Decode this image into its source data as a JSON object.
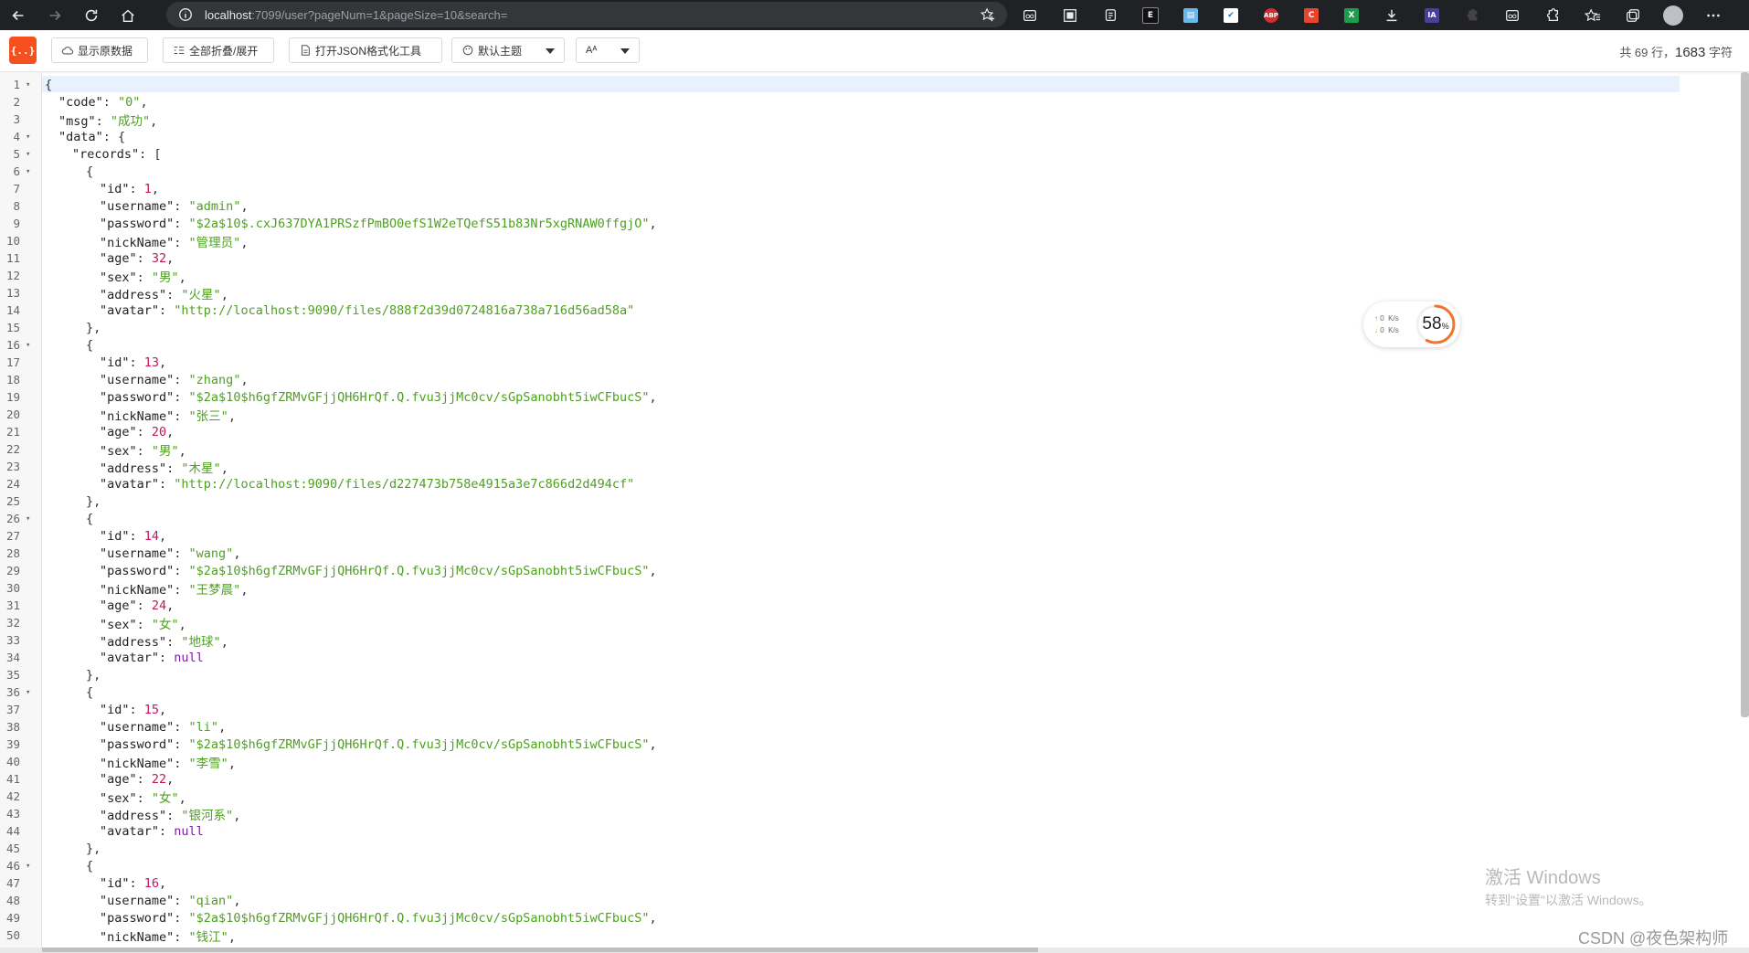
{
  "browser": {
    "url_host": "localhost",
    "url_rest": ":7099/user?pageNum=1&pageSize=10&search="
  },
  "toolbar": {
    "logo_text": "{..}",
    "show_raw_label": "显示原数据",
    "collapse_all_label": "全部折叠/展开",
    "open_tool_label": "打开JSON格式化工具",
    "theme_label": "默认主题",
    "font_label": "Aᴬ",
    "stats_lines": "共 69 行，",
    "stats_chars": "1683",
    "stats_chars_unit": " 字符"
  },
  "speed_widget": {
    "up_value": "0",
    "down_value": "0",
    "unit": "K/s",
    "percent": "58",
    "percent_sign": "%",
    "percent_fraction": 0.58
  },
  "watermark": {
    "title": "激活 Windows",
    "subtitle": "转到\"设置\"以激活 Windows。"
  },
  "csdn": "CSDN @夜色架构师",
  "json_lines": [
    {
      "n": "1",
      "f": "▾",
      "i": 0,
      "t": [
        [
          "b",
          "{"
        ]
      ]
    },
    {
      "n": "2",
      "f": "",
      "i": 1,
      "t": [
        [
          "k",
          "\"code\""
        ],
        [
          "p",
          ": "
        ],
        [
          "s",
          "\"0\""
        ],
        [
          "p",
          ","
        ]
      ]
    },
    {
      "n": "3",
      "f": "",
      "i": 1,
      "t": [
        [
          "k",
          "\"msg\""
        ],
        [
          "p",
          ": "
        ],
        [
          "s",
          "\"成功\""
        ],
        [
          "p",
          ","
        ]
      ]
    },
    {
      "n": "4",
      "f": "▾",
      "i": 1,
      "t": [
        [
          "k",
          "\"data\""
        ],
        [
          "p",
          ": "
        ],
        [
          "b",
          "{"
        ]
      ]
    },
    {
      "n": "5",
      "f": "▾",
      "i": 2,
      "t": [
        [
          "k",
          "\"records\""
        ],
        [
          "p",
          ": "
        ],
        [
          "b",
          "["
        ]
      ]
    },
    {
      "n": "6",
      "f": "▾",
      "i": 3,
      "t": [
        [
          "b",
          "{"
        ]
      ]
    },
    {
      "n": "7",
      "f": "",
      "i": 4,
      "t": [
        [
          "k",
          "\"id\""
        ],
        [
          "p",
          ": "
        ],
        [
          "n",
          "1"
        ],
        [
          "p",
          ","
        ]
      ]
    },
    {
      "n": "8",
      "f": "",
      "i": 4,
      "t": [
        [
          "k",
          "\"username\""
        ],
        [
          "p",
          ": "
        ],
        [
          "s",
          "\"admin\""
        ],
        [
          "p",
          ","
        ]
      ]
    },
    {
      "n": "9",
      "f": "",
      "i": 4,
      "t": [
        [
          "k",
          "\"password\""
        ],
        [
          "p",
          ": "
        ],
        [
          "s",
          "\"$2a$10$.cxJ637DYA1PRSzfPmBO0efS1W2eTQefS51b83Nr5xgRNAW0ffgjO\""
        ],
        [
          "p",
          ","
        ]
      ]
    },
    {
      "n": "10",
      "f": "",
      "i": 4,
      "t": [
        [
          "k",
          "\"nickName\""
        ],
        [
          "p",
          ": "
        ],
        [
          "s",
          "\"管理员\""
        ],
        [
          "p",
          ","
        ]
      ]
    },
    {
      "n": "11",
      "f": "",
      "i": 4,
      "t": [
        [
          "k",
          "\"age\""
        ],
        [
          "p",
          ": "
        ],
        [
          "n",
          "32"
        ],
        [
          "p",
          ","
        ]
      ]
    },
    {
      "n": "12",
      "f": "",
      "i": 4,
      "t": [
        [
          "k",
          "\"sex\""
        ],
        [
          "p",
          ": "
        ],
        [
          "s",
          "\"男\""
        ],
        [
          "p",
          ","
        ]
      ]
    },
    {
      "n": "13",
      "f": "",
      "i": 4,
      "t": [
        [
          "k",
          "\"address\""
        ],
        [
          "p",
          ": "
        ],
        [
          "s",
          "\"火星\""
        ],
        [
          "p",
          ","
        ]
      ]
    },
    {
      "n": "14",
      "f": "",
      "i": 4,
      "t": [
        [
          "k",
          "\"avatar\""
        ],
        [
          "p",
          ": "
        ],
        [
          "s",
          "\"http://localhost:9090/files/888f2d39d0724816a738a716d56ad58a\""
        ]
      ]
    },
    {
      "n": "15",
      "f": "",
      "i": 3,
      "t": [
        [
          "b",
          "}"
        ],
        [
          "p",
          ","
        ]
      ]
    },
    {
      "n": "16",
      "f": "▾",
      "i": 3,
      "t": [
        [
          "b",
          "{"
        ]
      ]
    },
    {
      "n": "17",
      "f": "",
      "i": 4,
      "t": [
        [
          "k",
          "\"id\""
        ],
        [
          "p",
          ": "
        ],
        [
          "n",
          "13"
        ],
        [
          "p",
          ","
        ]
      ]
    },
    {
      "n": "18",
      "f": "",
      "i": 4,
      "t": [
        [
          "k",
          "\"username\""
        ],
        [
          "p",
          ": "
        ],
        [
          "s",
          "\"zhang\""
        ],
        [
          "p",
          ","
        ]
      ]
    },
    {
      "n": "19",
      "f": "",
      "i": 4,
      "t": [
        [
          "k",
          "\"password\""
        ],
        [
          "p",
          ": "
        ],
        [
          "s",
          "\"$2a$10$h6gfZRMvGFjjQH6HrQf.Q.fvu3jjMc0cv/sGpSanobht5iwCFbucS\""
        ],
        [
          "p",
          ","
        ]
      ]
    },
    {
      "n": "20",
      "f": "",
      "i": 4,
      "t": [
        [
          "k",
          "\"nickName\""
        ],
        [
          "p",
          ": "
        ],
        [
          "s",
          "\"张三\""
        ],
        [
          "p",
          ","
        ]
      ]
    },
    {
      "n": "21",
      "f": "",
      "i": 4,
      "t": [
        [
          "k",
          "\"age\""
        ],
        [
          "p",
          ": "
        ],
        [
          "n",
          "20"
        ],
        [
          "p",
          ","
        ]
      ]
    },
    {
      "n": "22",
      "f": "",
      "i": 4,
      "t": [
        [
          "k",
          "\"sex\""
        ],
        [
          "p",
          ": "
        ],
        [
          "s",
          "\"男\""
        ],
        [
          "p",
          ","
        ]
      ]
    },
    {
      "n": "23",
      "f": "",
      "i": 4,
      "t": [
        [
          "k",
          "\"address\""
        ],
        [
          "p",
          ": "
        ],
        [
          "s",
          "\"木星\""
        ],
        [
          "p",
          ","
        ]
      ]
    },
    {
      "n": "24",
      "f": "",
      "i": 4,
      "t": [
        [
          "k",
          "\"avatar\""
        ],
        [
          "p",
          ": "
        ],
        [
          "s",
          "\"http://localhost:9090/files/d227473b758e4915a3e7c866d2d494cf\""
        ]
      ]
    },
    {
      "n": "25",
      "f": "",
      "i": 3,
      "t": [
        [
          "b",
          "}"
        ],
        [
          "p",
          ","
        ]
      ]
    },
    {
      "n": "26",
      "f": "▾",
      "i": 3,
      "t": [
        [
          "b",
          "{"
        ]
      ]
    },
    {
      "n": "27",
      "f": "",
      "i": 4,
      "t": [
        [
          "k",
          "\"id\""
        ],
        [
          "p",
          ": "
        ],
        [
          "n",
          "14"
        ],
        [
          "p",
          ","
        ]
      ]
    },
    {
      "n": "28",
      "f": "",
      "i": 4,
      "t": [
        [
          "k",
          "\"username\""
        ],
        [
          "p",
          ": "
        ],
        [
          "s",
          "\"wang\""
        ],
        [
          "p",
          ","
        ]
      ]
    },
    {
      "n": "29",
      "f": "",
      "i": 4,
      "t": [
        [
          "k",
          "\"password\""
        ],
        [
          "p",
          ": "
        ],
        [
          "s",
          "\"$2a$10$h6gfZRMvGFjjQH6HrQf.Q.fvu3jjMc0cv/sGpSanobht5iwCFbucS\""
        ],
        [
          "p",
          ","
        ]
      ]
    },
    {
      "n": "30",
      "f": "",
      "i": 4,
      "t": [
        [
          "k",
          "\"nickName\""
        ],
        [
          "p",
          ": "
        ],
        [
          "s",
          "\"王梦晨\""
        ],
        [
          "p",
          ","
        ]
      ]
    },
    {
      "n": "31",
      "f": "",
      "i": 4,
      "t": [
        [
          "k",
          "\"age\""
        ],
        [
          "p",
          ": "
        ],
        [
          "n",
          "24"
        ],
        [
          "p",
          ","
        ]
      ]
    },
    {
      "n": "32",
      "f": "",
      "i": 4,
      "t": [
        [
          "k",
          "\"sex\""
        ],
        [
          "p",
          ": "
        ],
        [
          "s",
          "\"女\""
        ],
        [
          "p",
          ","
        ]
      ]
    },
    {
      "n": "33",
      "f": "",
      "i": 4,
      "t": [
        [
          "k",
          "\"address\""
        ],
        [
          "p",
          ": "
        ],
        [
          "s",
          "\"地球\""
        ],
        [
          "p",
          ","
        ]
      ]
    },
    {
      "n": "34",
      "f": "",
      "i": 4,
      "t": [
        [
          "k",
          "\"avatar\""
        ],
        [
          "p",
          ": "
        ],
        [
          "u",
          "null"
        ]
      ]
    },
    {
      "n": "35",
      "f": "",
      "i": 3,
      "t": [
        [
          "b",
          "}"
        ],
        [
          "p",
          ","
        ]
      ]
    },
    {
      "n": "36",
      "f": "▾",
      "i": 3,
      "t": [
        [
          "b",
          "{"
        ]
      ]
    },
    {
      "n": "37",
      "f": "",
      "i": 4,
      "t": [
        [
          "k",
          "\"id\""
        ],
        [
          "p",
          ": "
        ],
        [
          "n",
          "15"
        ],
        [
          "p",
          ","
        ]
      ]
    },
    {
      "n": "38",
      "f": "",
      "i": 4,
      "t": [
        [
          "k",
          "\"username\""
        ],
        [
          "p",
          ": "
        ],
        [
          "s",
          "\"li\""
        ],
        [
          "p",
          ","
        ]
      ]
    },
    {
      "n": "39",
      "f": "",
      "i": 4,
      "t": [
        [
          "k",
          "\"password\""
        ],
        [
          "p",
          ": "
        ],
        [
          "s",
          "\"$2a$10$h6gfZRMvGFjjQH6HrQf.Q.fvu3jjMc0cv/sGpSanobht5iwCFbucS\""
        ],
        [
          "p",
          ","
        ]
      ]
    },
    {
      "n": "40",
      "f": "",
      "i": 4,
      "t": [
        [
          "k",
          "\"nickName\""
        ],
        [
          "p",
          ": "
        ],
        [
          "s",
          "\"李雪\""
        ],
        [
          "p",
          ","
        ]
      ]
    },
    {
      "n": "41",
      "f": "",
      "i": 4,
      "t": [
        [
          "k",
          "\"age\""
        ],
        [
          "p",
          ": "
        ],
        [
          "n",
          "22"
        ],
        [
          "p",
          ","
        ]
      ]
    },
    {
      "n": "42",
      "f": "",
      "i": 4,
      "t": [
        [
          "k",
          "\"sex\""
        ],
        [
          "p",
          ": "
        ],
        [
          "s",
          "\"女\""
        ],
        [
          "p",
          ","
        ]
      ]
    },
    {
      "n": "43",
      "f": "",
      "i": 4,
      "t": [
        [
          "k",
          "\"address\""
        ],
        [
          "p",
          ": "
        ],
        [
          "s",
          "\"银河系\""
        ],
        [
          "p",
          ","
        ]
      ]
    },
    {
      "n": "44",
      "f": "",
      "i": 4,
      "t": [
        [
          "k",
          "\"avatar\""
        ],
        [
          "p",
          ": "
        ],
        [
          "u",
          "null"
        ]
      ]
    },
    {
      "n": "45",
      "f": "",
      "i": 3,
      "t": [
        [
          "b",
          "}"
        ],
        [
          "p",
          ","
        ]
      ]
    },
    {
      "n": "46",
      "f": "▾",
      "i": 3,
      "t": [
        [
          "b",
          "{"
        ]
      ]
    },
    {
      "n": "47",
      "f": "",
      "i": 4,
      "t": [
        [
          "k",
          "\"id\""
        ],
        [
          "p",
          ": "
        ],
        [
          "n",
          "16"
        ],
        [
          "p",
          ","
        ]
      ]
    },
    {
      "n": "48",
      "f": "",
      "i": 4,
      "t": [
        [
          "k",
          "\"username\""
        ],
        [
          "p",
          ": "
        ],
        [
          "s",
          "\"qian\""
        ],
        [
          "p",
          ","
        ]
      ]
    },
    {
      "n": "49",
      "f": "",
      "i": 4,
      "t": [
        [
          "k",
          "\"password\""
        ],
        [
          "p",
          ": "
        ],
        [
          "s",
          "\"$2a$10$h6gfZRMvGFjjQH6HrQf.Q.fvu3jjMc0cv/sGpSanobht5iwCFbucS\""
        ],
        [
          "p",
          ","
        ]
      ]
    },
    {
      "n": "50",
      "f": "",
      "i": 4,
      "t": [
        [
          "k",
          "\"nickName\""
        ],
        [
          "p",
          ": "
        ],
        [
          "s",
          "\"钱江\""
        ],
        [
          "p",
          ","
        ]
      ]
    }
  ]
}
